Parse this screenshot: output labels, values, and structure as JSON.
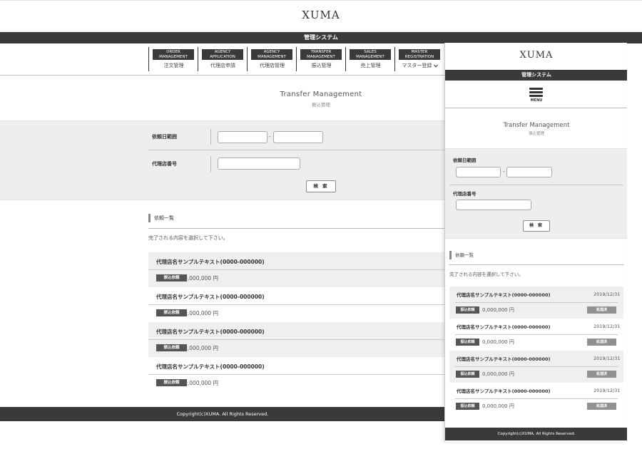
{
  "brand": {
    "logo": "XUMA",
    "system_name": "管理システム"
  },
  "nav": [
    {
      "en": "ORDER MANAGEMENT",
      "ja": "注文管理"
    },
    {
      "en": "AGENCY APPLICATION",
      "ja": "代理店申請"
    },
    {
      "en": "AGENCY MANAGEMENT",
      "ja": "代理店管理"
    },
    {
      "en": "TRANSFER MANAGEMENT",
      "ja": "振込管理"
    },
    {
      "en": "SALES MANAGEMENT",
      "ja": "売上管理"
    },
    {
      "en": "MASTER REGISTRATION",
      "ja": "マスター登録"
    }
  ],
  "page": {
    "title_en": "Transfer Management",
    "title_ja": "振込管理"
  },
  "filter": {
    "date_range_label": "依頼日範囲",
    "date_from": "",
    "date_to": "",
    "separator": "-",
    "agency_no_label": "代理店番号",
    "agency_no": "",
    "search_button": "検 索"
  },
  "list": {
    "title": "依頼一覧",
    "note": "完了される内容を選択して下さい。",
    "rows": [
      {
        "name": "代理店名サンプルテキスト(0000-000000)",
        "badge": "振込依頼",
        "amount": "0,000,000 円",
        "date": "2019/12/31",
        "status": "処理済"
      },
      {
        "name": "代理店名サンプルテキスト(0000-000000)",
        "badge": "振込依頼",
        "amount": "0,000,000 円",
        "date": "2019/12/31",
        "status": "処理済"
      },
      {
        "name": "代理店名サンプルテキスト(0000-000000)",
        "badge": "振込依頼",
        "amount": "0,000,000 円",
        "date": "2019/12/31",
        "status": "処理済"
      },
      {
        "name": "代理店名サンプルテキスト(0000-000000)",
        "badge": "振込依頼",
        "amount": "0,000,000 円",
        "date": "2019/12/31",
        "status": "処理済"
      }
    ]
  },
  "mobile": {
    "menu_label": "MENU"
  },
  "footer": {
    "copyright": "Copyright(c)XUMA. All Rights Reserved."
  },
  "icons": {
    "menu": "hamburger-menu-icon",
    "dropdown": "chevron-down-icon"
  },
  "colors": {
    "dark_bar": "#3a3a3a",
    "badge": "#555555",
    "status": "#909090",
    "filter_bg": "#eeeeee"
  }
}
